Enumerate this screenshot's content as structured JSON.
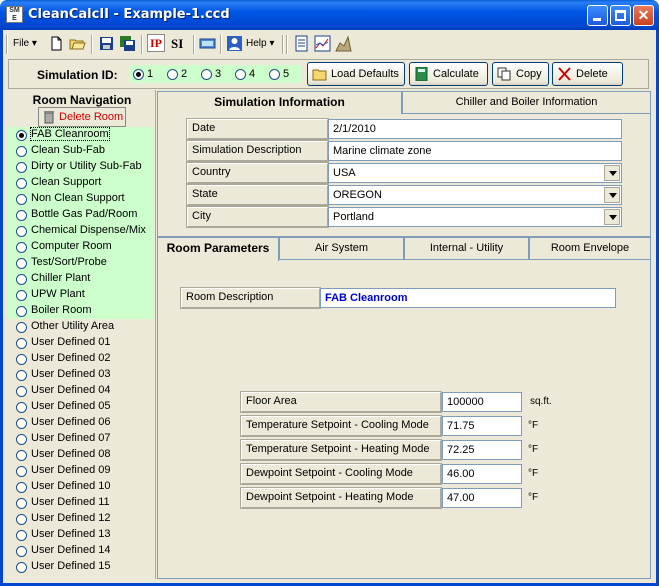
{
  "window": {
    "title": "CleanCalcII - Example-1.ccd",
    "app_icon_text": "SMR\nE"
  },
  "menu": {
    "file_label": "File",
    "help_label": "Help",
    "ip_label": "IP",
    "si_label": "SI"
  },
  "simulation": {
    "label": "Simulation ID:",
    "options": [
      "1",
      "2",
      "3",
      "4",
      "5"
    ],
    "selected": "1",
    "buttons": {
      "load_defaults": "Load Defaults",
      "calculate": "Calculate",
      "copy": "Copy",
      "delete": "Delete"
    }
  },
  "nav": {
    "title": "Room Navigation",
    "delete_room": "Delete Room",
    "rooms": [
      "FAB Cleanroom",
      "Clean Sub-Fab",
      "Dirty or Utility Sub-Fab",
      "Clean Support",
      "Non Clean Support",
      "Bottle Gas Pad/Room",
      "Chemical Dispense/Mix",
      "Computer Room",
      "Test/Sort/Probe",
      "Chiller Plant",
      "UPW Plant",
      "Boiler Room",
      "Other Utility Area",
      "User Defined 01",
      "User Defined 02",
      "User Defined 03",
      "User Defined 04",
      "User Defined 05",
      "User Defined 06",
      "User Defined 07",
      "User Defined 08",
      "User Defined 09",
      "User Defined 10",
      "User Defined 11",
      "User Defined 12",
      "User Defined 13",
      "User Defined 14",
      "User Defined 15"
    ]
  },
  "top_tabs": {
    "sim_info": "Simulation Information",
    "chiller": "Chiller and Boiler Information"
  },
  "sim_info": {
    "date_label": "Date",
    "date_value": "2/1/2010",
    "desc_label": "Simulation Description",
    "desc_value": "Marine climate zone",
    "country_label": "Country",
    "country_value": "USA",
    "state_label": "State",
    "state_value": "OREGON",
    "city_label": "City",
    "city_value": "Portland"
  },
  "room_tabs": {
    "params": "Room Parameters",
    "air": "Air System",
    "internal": "Internal - Utility",
    "envelope": "Room Envelope"
  },
  "room_params": {
    "desc_label": "Room Description",
    "desc_value": "FAB Cleanroom",
    "floor_label": "Floor Area",
    "floor_value": "100000",
    "floor_unit": "sq.ft.",
    "temp_cool_label": "Temperature Setpoint - Cooling Mode",
    "temp_cool_value": "71.75",
    "temp_cool_unit": "°F",
    "temp_heat_label": "Temperature Setpoint - Heating Mode",
    "temp_heat_value": "72.25",
    "temp_heat_unit": "°F",
    "dew_cool_label": "Dewpoint Setpoint - Cooling Mode",
    "dew_cool_value": "46.00",
    "dew_cool_unit": "°F",
    "dew_heat_label": "Dewpoint Setpoint - Heating Mode",
    "dew_heat_value": "47.00",
    "dew_heat_unit": "°F"
  }
}
